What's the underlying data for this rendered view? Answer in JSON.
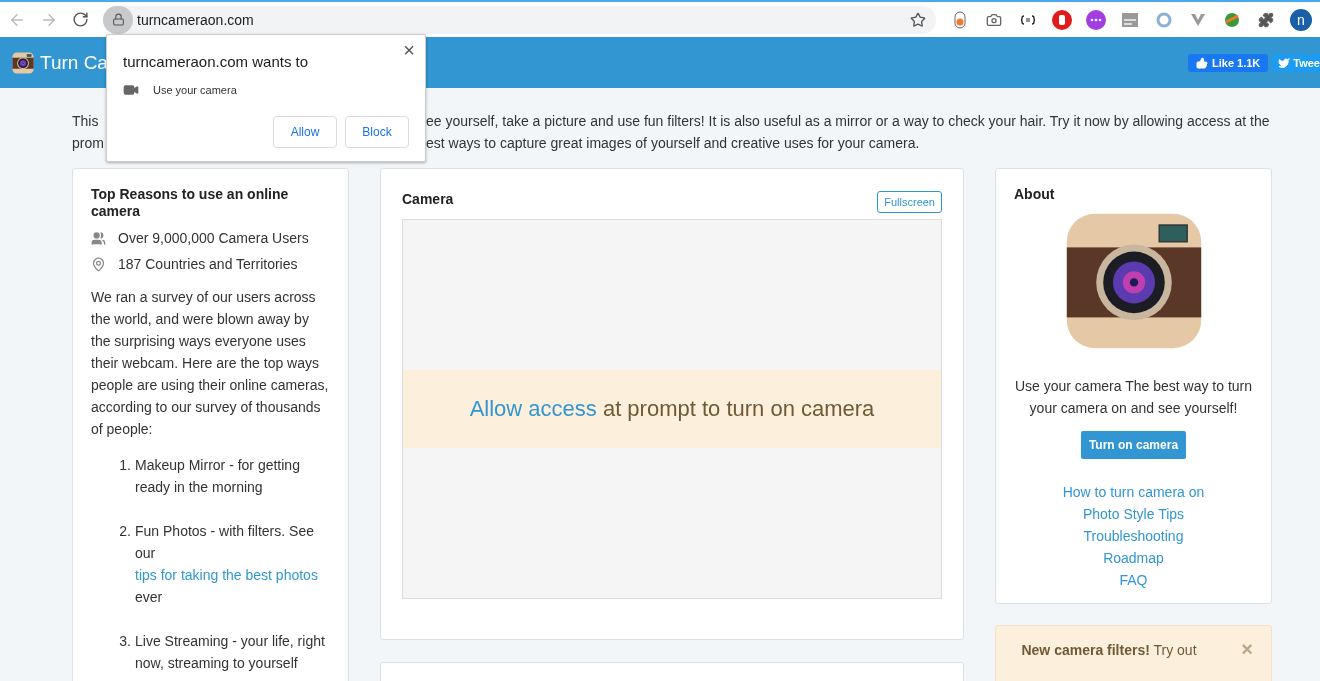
{
  "browser": {
    "url": "turncameraon.com",
    "avatar": "n"
  },
  "permission_popup": {
    "title": "turncameraon.com wants to",
    "request": "Use your camera",
    "buttons": [
      "Allow",
      "Block"
    ],
    "close": "×"
  },
  "header": {
    "title": "Turn Ca",
    "like": "Like 1.1K",
    "tweet": "Twee"
  },
  "intro": {
    "lines": [
      {
        "left": "This",
        "right": "ee yourself, take a picture and use fun filters! It is also useful as a mirror or a way to check your hair. Try it now by allowing access at the"
      },
      {
        "left": "prom",
        "right": "est ways to capture great images of yourself and creative uses for your camera."
      }
    ]
  },
  "reasons": {
    "title": "Top Reasons to use an online camera",
    "stats": [
      {
        "kind": "users",
        "text": "Over 9,000,000 Camera Users"
      },
      {
        "kind": "location",
        "text": "187 Countries and Territories"
      }
    ],
    "body": "We ran a survey of our users across the world, and were blown away by the surprising ways everyone uses their webcam. Here are the top ways people are using their online cameras, according to our survey of thousands of people:",
    "items": [
      {
        "number": "1.",
        "parts": [
          {
            "kind": "text",
            "text": "Makeup Mirror - for getting ready in the morning"
          }
        ]
      },
      {
        "number": "2.",
        "parts": [
          {
            "kind": "text",
            "text": "Fun Photos - with filters. See our "
          },
          {
            "kind": "link",
            "text": "tips for taking the best photos"
          },
          {
            "kind": "text",
            "text": " ever"
          }
        ]
      },
      {
        "number": "3.",
        "parts": [
          {
            "kind": "text",
            "text": "Live Streaming - your life, right now, streaming to yourself"
          }
        ]
      }
    ]
  },
  "camera": {
    "title": "Camera",
    "fullscreen": "Fullscreen",
    "prompt_link": "Allow access",
    "prompt_text": " at prompt to turn on camera"
  },
  "about": {
    "title": "About",
    "text": "Use your camera The best way to turn your camera on and see yourself!",
    "button": "Turn on camera",
    "links": [
      "How to turn camera on",
      "Photo Style Tips",
      "Troubleshooting",
      "Roadmap",
      "FAQ"
    ]
  },
  "notice": {
    "text": "**New camera filters!** Try out",
    "close": "×"
  }
}
